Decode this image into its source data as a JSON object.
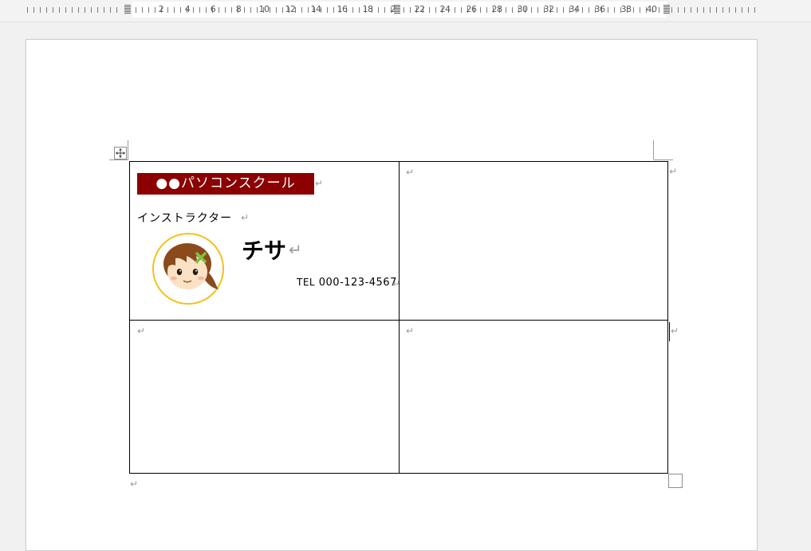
{
  "ruler": {
    "numbers": [
      "2",
      "4",
      "6",
      "8",
      "10",
      "12",
      "14",
      "16",
      "18",
      "2",
      "22",
      "24",
      "26",
      "28",
      "30",
      "32",
      "34",
      "36",
      "38",
      "40"
    ]
  },
  "card": {
    "school_name": "●●パソコンスクール",
    "role": "インストラクター",
    "instructor_name": "チサ",
    "tel_label": "TEL",
    "tel_number": "000-123-4567"
  },
  "marks": {
    "paragraph": "↵"
  },
  "colors": {
    "banner_bg": "#8b0000",
    "avatar_ring": "#f3c21b",
    "hair": "#8a4a1c",
    "face": "#fbe2c5",
    "hair_clip": "#7dc142"
  }
}
